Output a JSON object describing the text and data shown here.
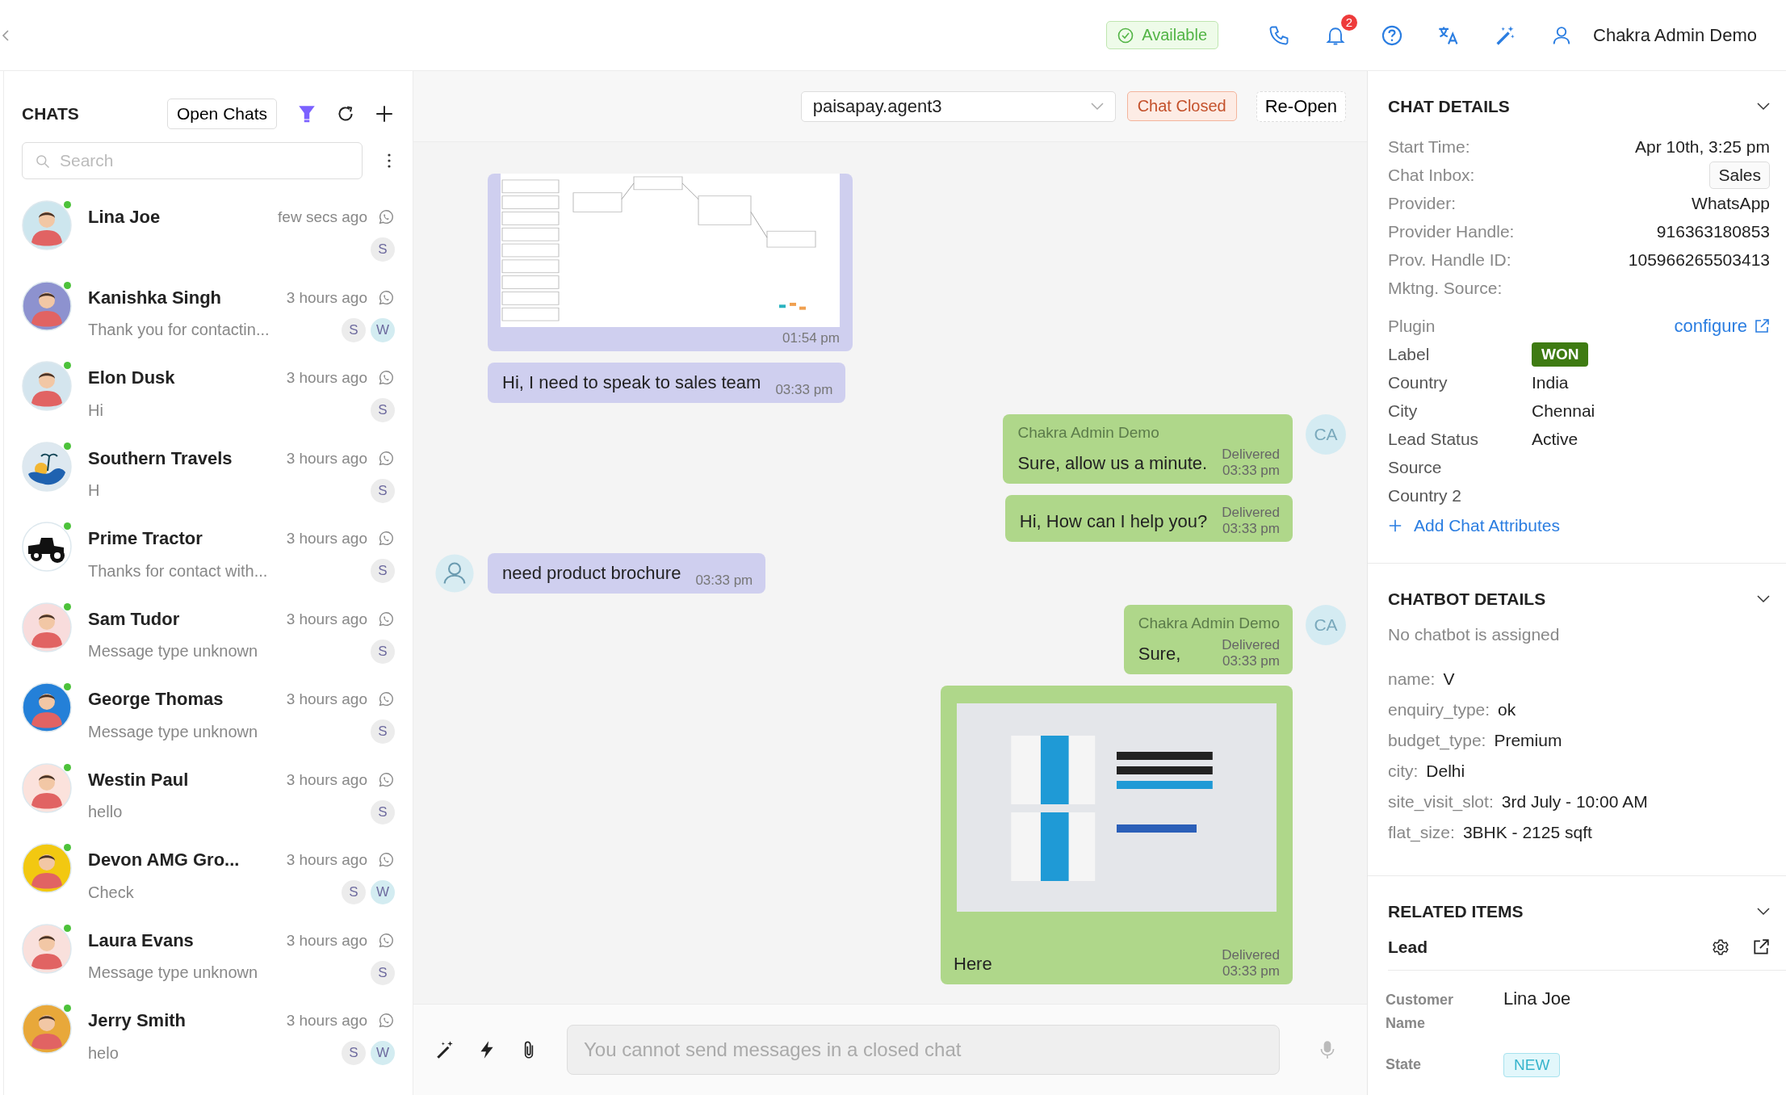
{
  "top_bar": {
    "status": "Available",
    "notifications": "2",
    "user": "Chakra Admin Demo"
  },
  "chats_panel": {
    "title": "CHATS",
    "filter_button": "Open Chats",
    "search": {
      "placeholder": "Search"
    },
    "chats": [
      {
        "name": "Lina Joe",
        "time": "few secs ago",
        "kind": "person",
        "color": "#cde6ee",
        "online": true,
        "tags": [
          {
            "text": "S",
            "color": "#ececec"
          }
        ]
      },
      {
        "name": "Kanishka Singh",
        "time": "3 hours ago",
        "preview": "Thank you for contactin...",
        "kind": "person",
        "color": "#8d92cf",
        "online": true,
        "tags": [
          {
            "text": "S",
            "color": "#ececec"
          },
          {
            "text": "W",
            "color": "#d3ecf1"
          }
        ]
      },
      {
        "name": "Elon Dusk",
        "time": "3 hours ago",
        "preview": "Hi",
        "kind": "person",
        "color": "#d4e5ee",
        "online": true,
        "tags": [
          {
            "text": "S",
            "color": "#ececec"
          }
        ]
      },
      {
        "name": "Southern Travels",
        "time": "3 hours ago",
        "preview": "H",
        "kind": "beach",
        "color": "#dde8f0",
        "online": true,
        "tags": [
          {
            "text": "S",
            "color": "#ececec"
          }
        ]
      },
      {
        "name": "Prime Tractor",
        "time": "3 hours ago",
        "preview": "Thanks for contact with...",
        "kind": "tractor",
        "online": true,
        "tags": [
          {
            "text": "S",
            "color": "#ececec"
          }
        ]
      },
      {
        "name": "Sam Tudor",
        "time": "3 hours ago",
        "preview": "Message type unknown",
        "kind": "person",
        "color": "#f8dcdc",
        "online": true,
        "tags": [
          {
            "text": "S",
            "color": "#ececec"
          }
        ]
      },
      {
        "name": "George Thomas",
        "time": "3 hours ago",
        "preview": "Message type unknown",
        "kind": "person",
        "color": "#2480d8",
        "online": true,
        "tags": [
          {
            "text": "S",
            "color": "#ececec"
          }
        ]
      },
      {
        "name": "Westin Paul",
        "time": "3 hours ago",
        "preview": "hello",
        "kind": "person",
        "color": "#fbe2dc",
        "online": true,
        "tags": [
          {
            "text": "S",
            "color": "#ececec"
          }
        ]
      },
      {
        "name": "Devon AMG Gro...",
        "time": "3 hours ago",
        "preview": "Check",
        "kind": "person",
        "color": "#f2c811",
        "online": true,
        "tags": [
          {
            "text": "S",
            "color": "#ececec"
          },
          {
            "text": "W",
            "color": "#d3ecf1"
          }
        ]
      },
      {
        "name": "Laura Evans",
        "time": "3 hours ago",
        "preview": "Message type unknown",
        "kind": "person",
        "color": "#f9e0dc",
        "online": true,
        "tags": [
          {
            "text": "S",
            "color": "#ececec"
          }
        ]
      },
      {
        "name": "Jerry Smith",
        "time": "3 hours ago",
        "preview": "helo",
        "kind": "person",
        "color": "#e8a83a",
        "online": true,
        "tags": [
          {
            "text": "S",
            "color": "#ececec"
          },
          {
            "text": "W",
            "color": "#d3ecf1"
          }
        ]
      }
    ]
  },
  "conversation": {
    "agent": "paisapay.agent3",
    "status": "Chat Closed",
    "reopen_button": "Re-Open",
    "messages": [
      {
        "outgoing": false,
        "kind": "image",
        "time": "01:54 pm"
      },
      {
        "outgoing": false,
        "kind": "text",
        "text": "Hi, I need to speak to sales team",
        "time": "03:33 pm"
      },
      {
        "outgoing": true,
        "kind": "text",
        "sender": "Chakra Admin Demo",
        "text": "Sure, allow us a minute.",
        "status": "Delivered",
        "time": "03:33 pm",
        "avatar": "CA"
      },
      {
        "outgoing": true,
        "kind": "text",
        "text": "Hi, How can I help you?",
        "status": "Delivered",
        "time": "03:33 pm"
      },
      {
        "outgoing": false,
        "kind": "text",
        "text": "need product brochure",
        "time": "03:33 pm",
        "show_avatar": true
      },
      {
        "outgoing": true,
        "kind": "text",
        "sender": "Chakra Admin Demo",
        "text": "Sure,",
        "status": "Delivered",
        "time": "03:33 pm",
        "avatar": "CA"
      },
      {
        "outgoing": true,
        "kind": "image",
        "text": "Here",
        "status": "Delivered",
        "time": "03:33 pm"
      }
    ],
    "composer": {
      "placeholder": "You cannot send messages in a closed chat",
      "disabled": true
    }
  },
  "details_panel": {
    "chat_details": {
      "title": "CHAT DETAILS",
      "fields": [
        {
          "label": "Start Time:",
          "value": "Apr 10th, 3:25 pm",
          "kind": "text"
        },
        {
          "label": "Chat Inbox:",
          "value": "Sales",
          "kind": "pill"
        },
        {
          "label": "Provider:",
          "value": "WhatsApp",
          "kind": "text"
        },
        {
          "label": "Provider Handle:",
          "value": "916363180853",
          "kind": "text"
        },
        {
          "label": "Prov. Handle ID:",
          "value": "105966265503413",
          "kind": "text"
        },
        {
          "label": "Mktng. Source:",
          "kind": "text"
        }
      ],
      "plugin": {
        "label": "Plugin",
        "link": "configure"
      },
      "attributes": [
        {
          "label": "Label",
          "value": "WON",
          "kind": "badge"
        },
        {
          "label": "Country",
          "value": "India",
          "kind": "text"
        },
        {
          "label": "City",
          "value": "Chennai",
          "kind": "text"
        },
        {
          "label": "Lead Status",
          "value": "Active",
          "kind": "text"
        },
        {
          "label": "Source",
          "kind": "text"
        },
        {
          "label": "Country 2",
          "kind": "text"
        }
      ],
      "add_button": "Add Chat Attributes"
    },
    "chatbot_details": {
      "title": "CHATBOT DETAILS",
      "note": "No chatbot is assigned",
      "fields": [
        {
          "label": "name:",
          "value": "V"
        },
        {
          "label": "enquiry_type:",
          "value": "ok"
        },
        {
          "label": "budget_type:",
          "value": "Premium"
        },
        {
          "label": "city:",
          "value": "Delhi"
        },
        {
          "label": "site_visit_slot:",
          "value": "3rd July - 10:00 AM"
        },
        {
          "label": "flat_size:",
          "value": "3BHK - 2125 sqft"
        }
      ]
    },
    "related_items": {
      "title": "RELATED ITEMS",
      "item": "Lead",
      "fields": [
        {
          "label": "Customer Name",
          "value": "Lina Joe",
          "kind": "text"
        },
        {
          "label": "State",
          "value": "NEW",
          "kind": "badge"
        }
      ]
    }
  }
}
